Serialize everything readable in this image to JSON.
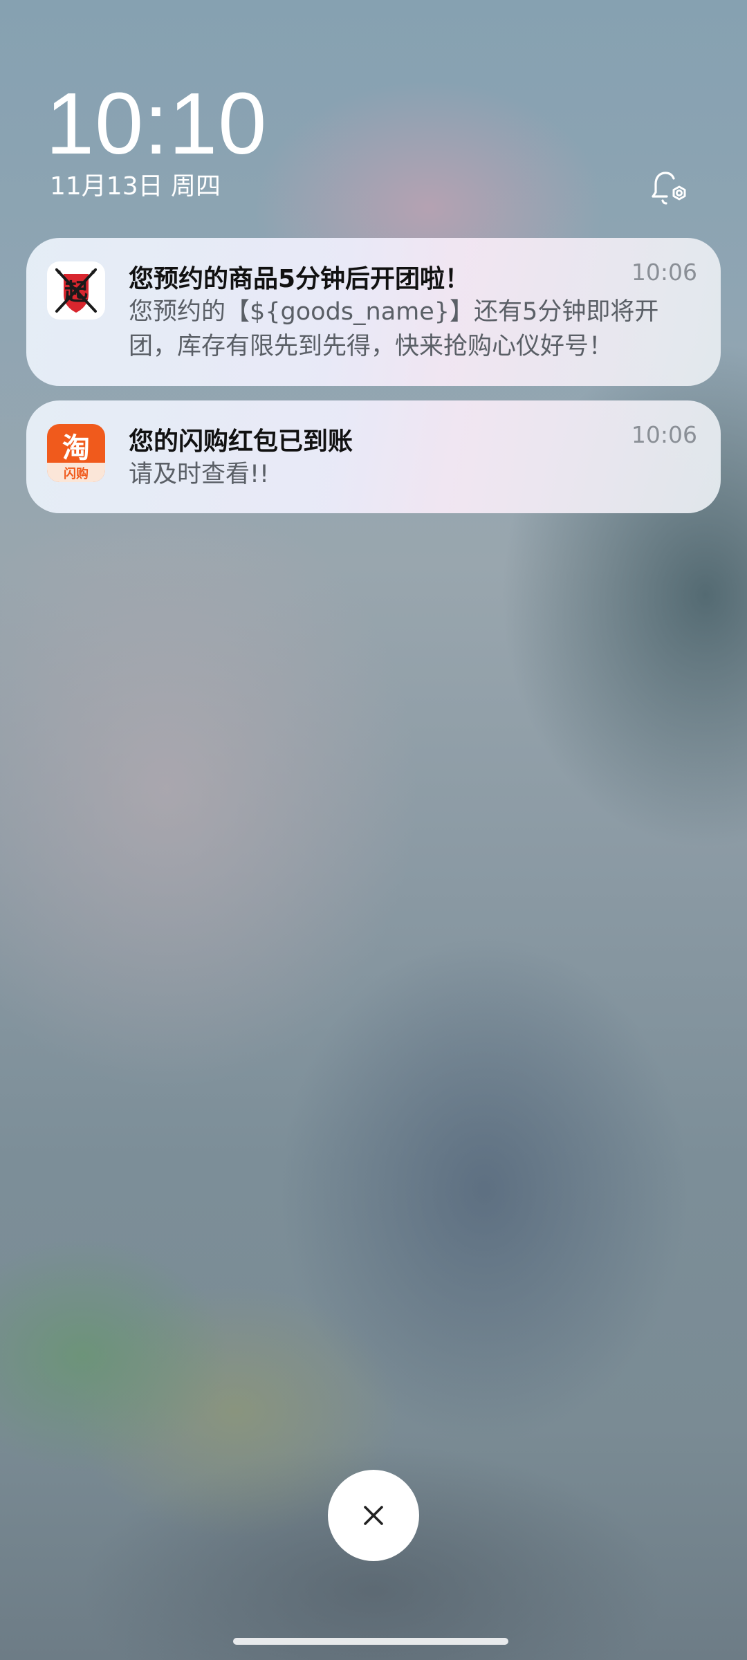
{
  "lockscreen": {
    "time": "10:10",
    "date": "11月13日 周四"
  },
  "notifications": [
    {
      "app_icon": "qi-app-icon",
      "icon_text": "起",
      "title": "您预约的商品5分钟后开团啦！",
      "time": "10:06",
      "body": "您预约的【${goods_name}】还有5分钟即将开团，库存有限先到先得，快来抢购心仪好号！"
    },
    {
      "app_icon": "taobao-shangou-app-icon",
      "icon_text_top": "淘",
      "icon_text_bottom": "闪购",
      "title": "您的闪购红包已到账",
      "time": "10:06",
      "body": "请及时查看!!"
    }
  ],
  "colors": {
    "notification_title": "#111111",
    "notification_body": "#5a5f66",
    "notification_time": "#8a8f96",
    "taobao_orange": "#f05a1c",
    "qi_red": "#d8262e"
  }
}
